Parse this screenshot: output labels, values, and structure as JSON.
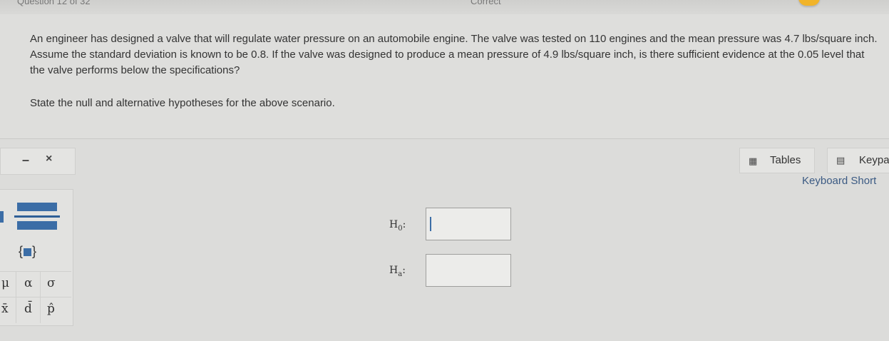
{
  "header": {
    "question_label": "Question 12 of 32",
    "status_label": "Correct"
  },
  "question": {
    "text": "An engineer has designed a valve that will regulate water pressure on an automobile engine.  The valve was tested on 110 engines and the mean pressure was 4.7 lbs/square inch.  Assume the standard deviation is known to be 0.8.  If the valve was designed to produce a mean pressure of 4.9 lbs/square inch, is there sufficient evidence at the 0.05 level that the valve performs below the specifications?",
    "prompt": "State the null and alternative hypotheses for the above scenario."
  },
  "tools": {
    "minus_label": "–",
    "close_label": "×",
    "tables_label": "Tables",
    "keypad_label": "Keypa",
    "shortcuts_label": "Keyboard Short"
  },
  "palette": {
    "set_open": "{",
    "set_close": "}",
    "row1": [
      "μ",
      "α",
      "σ"
    ],
    "row2": [
      "x̄",
      "d̄",
      "p̂"
    ]
  },
  "hypotheses": {
    "null_label": "H",
    "null_sub": "0",
    "null_value": "",
    "alt_label": "H",
    "alt_sub": "a",
    "alt_value": ""
  },
  "icons": {
    "tables": "table-icon",
    "keypad": "calculator-icon"
  },
  "colors": {
    "accent": "#3b6da6",
    "badge": "#f1b42a"
  }
}
